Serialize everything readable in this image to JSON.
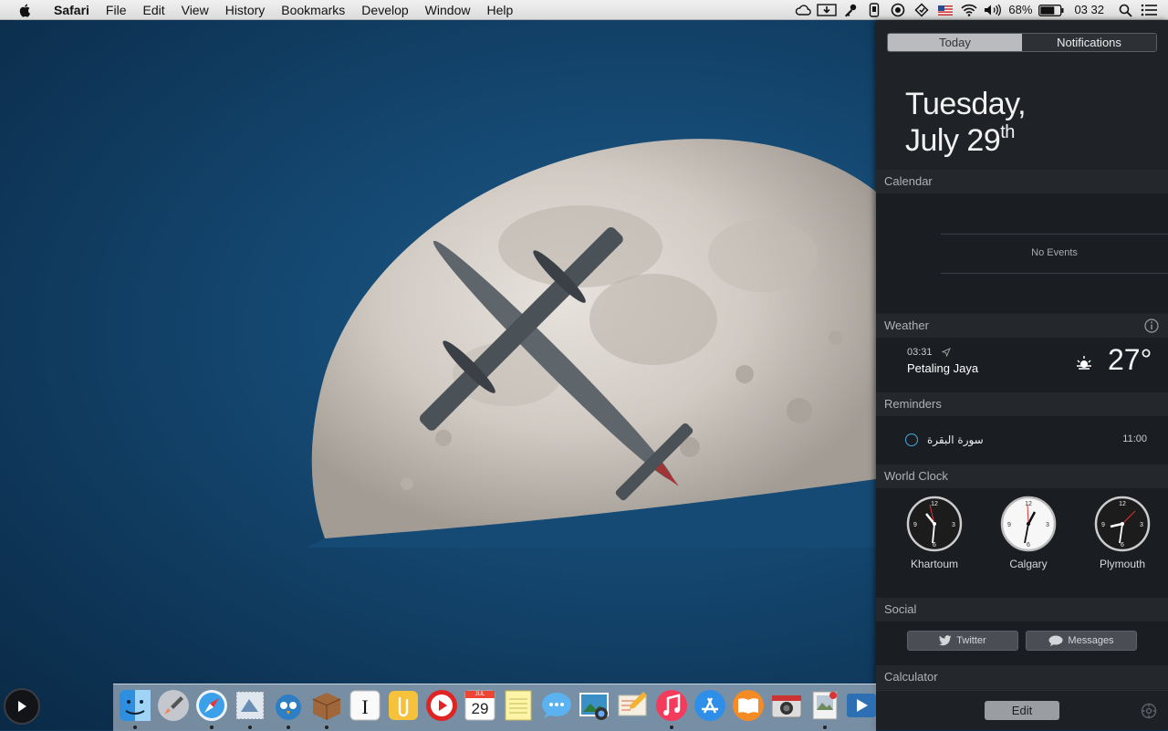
{
  "menubar": {
    "app_name": "Safari",
    "menus": [
      "File",
      "Edit",
      "View",
      "History",
      "Bookmarks",
      "Develop",
      "Window",
      "Help"
    ],
    "battery_percent": "68%",
    "clock": "03 32",
    "status_icons": [
      "cloud-icon",
      "download-icon",
      "key-icon",
      "phone-icon",
      "record-icon",
      "sync-icon",
      "us-flag-icon",
      "wifi-icon",
      "volume-icon",
      "battery-icon",
      "search-icon",
      "list-icon"
    ]
  },
  "notification_center": {
    "tabs": {
      "today": "Today",
      "notifications": "Notifications"
    },
    "date_line1": "Tuesday,",
    "date_line2": "July 29",
    "date_suffix": "th",
    "calendar": {
      "title": "Calendar",
      "empty": "No Events"
    },
    "weather": {
      "title": "Weather",
      "time": "03:31",
      "city": "Petaling Jaya",
      "temp": "27°"
    },
    "reminders": {
      "title": "Reminders",
      "items": [
        {
          "text": "سورة البقرة",
          "time": "11:00"
        }
      ]
    },
    "world_clock": {
      "title": "World Clock",
      "clocks": [
        {
          "city": "Khartoum"
        },
        {
          "city": "Calgary"
        },
        {
          "city": "Plymouth"
        }
      ]
    },
    "social": {
      "title": "Social",
      "twitter": "Twitter",
      "messages": "Messages"
    },
    "calculator": {
      "title": "Calculator"
    },
    "edit_label": "Edit"
  },
  "dock": {
    "calendar_month": "JUL",
    "calendar_day": "29",
    "apps": [
      "finder",
      "launchpad",
      "safari",
      "mail",
      "tweetbot",
      "package",
      "instapaper",
      "clips",
      "youtube",
      "calendar",
      "notes",
      "messages",
      "iphoto",
      "ecoute",
      "itunes",
      "app-store",
      "ibooks",
      "photo-booth",
      "preview",
      "quicktime"
    ]
  },
  "colors": {
    "accent": "#4aa8e0",
    "panel": "#1f2227",
    "wallpaper": "#154a74"
  }
}
